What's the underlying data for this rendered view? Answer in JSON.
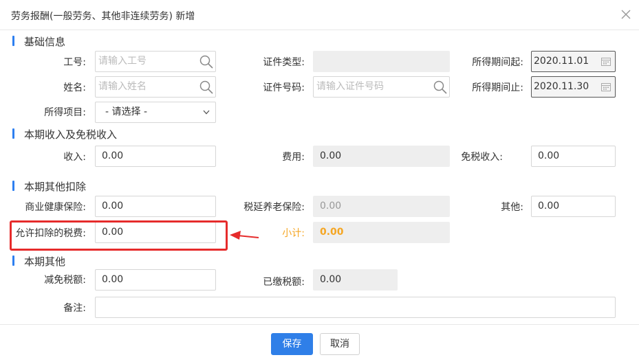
{
  "dialog": {
    "title": "劳务报酬(一般劳务、其他非连续劳务) 新增"
  },
  "sections": {
    "basic": "基础信息",
    "income": "本期收入及免税收入",
    "deduction": "本期其他扣除",
    "other": "本期其他"
  },
  "basic": {
    "employee_id_label": "工号:",
    "employee_id_placeholder": "请输入工号",
    "name_label": "姓名:",
    "name_placeholder": "请输入姓名",
    "income_item_label": "所得项目:",
    "income_item_value": "- 请选择 -",
    "id_type_label": "证件类型:",
    "id_type_value": "",
    "id_number_label": "证件号码:",
    "id_number_placeholder": "请输入证件号码",
    "period_start_label": "所得期间起:",
    "period_start_value": "2020.11.01",
    "period_end_label": "所得期间止:",
    "period_end_value": "2020.11.30"
  },
  "income": {
    "income_label": "收入:",
    "income_value": "0.00",
    "expense_label": "费用:",
    "expense_value": "0.00",
    "tax_free_label": "免税收入:",
    "tax_free_value": "0.00"
  },
  "deduction": {
    "health_label": "商业健康保险:",
    "health_value": "0.00",
    "pension_label": "税延养老保险:",
    "pension_value": "0.00",
    "other_label": "其他:",
    "other_value": "0.00",
    "allowed_tax_label": "允许扣除的税费:",
    "allowed_tax_value": "0.00",
    "subtotal_label": "小计:",
    "subtotal_value": "0.00"
  },
  "other": {
    "reduction_label": "减免税额:",
    "reduction_value": "0.00",
    "paid_label": "已缴税额:",
    "paid_value": "0.00",
    "remark_label": "备注:",
    "remark_value": ""
  },
  "footer": {
    "save_label": "保存",
    "cancel_label": "取消"
  },
  "colors": {
    "accent": "#2f7fe8",
    "highlight": "#e62b2b",
    "subtotal": "#f5a623"
  }
}
